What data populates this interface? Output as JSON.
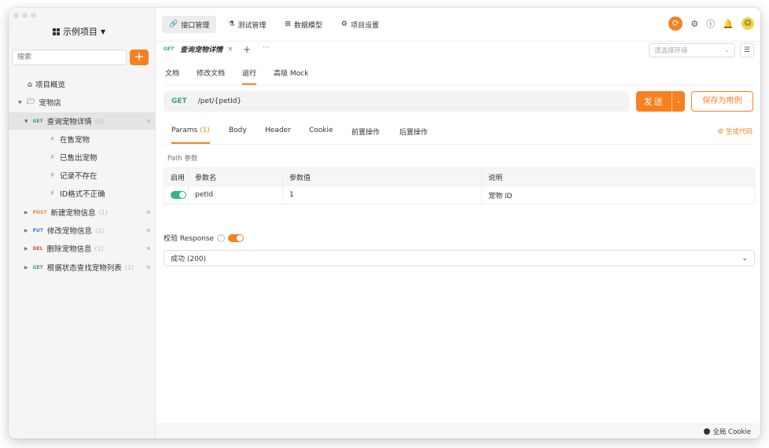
{
  "sidebar": {
    "project_title": "示例项目",
    "search_placeholder": "搜索",
    "add_label": "+",
    "items": [
      {
        "label": "项目概览"
      },
      {
        "label": "宠物店"
      },
      {
        "method": "GET",
        "label": "查询宠物详情",
        "count": "(4)"
      },
      {
        "label": "在售宠物"
      },
      {
        "label": "已售出宠物"
      },
      {
        "label": "记录不存在"
      },
      {
        "label": "ID格式不正确"
      },
      {
        "method": "POST",
        "label": "新建宠物信息",
        "count": "(1)"
      },
      {
        "method": "PUT",
        "label": "修改宠物信息",
        "count": "(2)"
      },
      {
        "method": "DEL",
        "label": "删除宠物信息",
        "count": "(1)"
      },
      {
        "method": "GET",
        "label": "根据状态查找宠物列表",
        "count": "(2)"
      }
    ]
  },
  "topnav": [
    {
      "label": "接口管理",
      "icon": "link-icon"
    },
    {
      "label": "测试管理",
      "icon": "flask-icon"
    },
    {
      "label": "数据模型",
      "icon": "model-icon"
    },
    {
      "label": "项目设置",
      "icon": "gear-icon"
    }
  ],
  "tab": {
    "method": "GET",
    "title": "查询宠物详情",
    "close": "×",
    "plus": "+",
    "more": "···"
  },
  "env": {
    "placeholder": "请选择环境",
    "menu": "☰"
  },
  "subtabs": [
    "文档",
    "修改文档",
    "运行",
    "高级 Mock"
  ],
  "request": {
    "method": "GET",
    "path": "/pet/{petId}",
    "send_label": "发送",
    "save_label": "保存为用例"
  },
  "param_tabs": [
    {
      "label": "Params",
      "count": "(1)"
    },
    {
      "label": "Body"
    },
    {
      "label": "Header"
    },
    {
      "label": "Cookie"
    },
    {
      "label": "前置操作"
    },
    {
      "label": "后置操作"
    }
  ],
  "gen_code": "⚙ 生成代码",
  "path_params_label": "Path 参数",
  "table": {
    "headers": [
      "启用",
      "参数名",
      "参数值",
      "说明"
    ],
    "rows": [
      {
        "name": "petId",
        "value": "1",
        "desc": "宠物 ID"
      }
    ]
  },
  "validate": {
    "label": "校验 Response",
    "help": "?"
  },
  "response_select": {
    "value": "成功 (200)"
  },
  "footer": {
    "cookie_label": "全局 Cookie"
  },
  "colors": {
    "accent": "#f7811f",
    "get": "#3aa56a",
    "post": "#e6883a",
    "put": "#3b7fd9",
    "del": "#e04848",
    "toggle_on": "#2fb58c"
  }
}
